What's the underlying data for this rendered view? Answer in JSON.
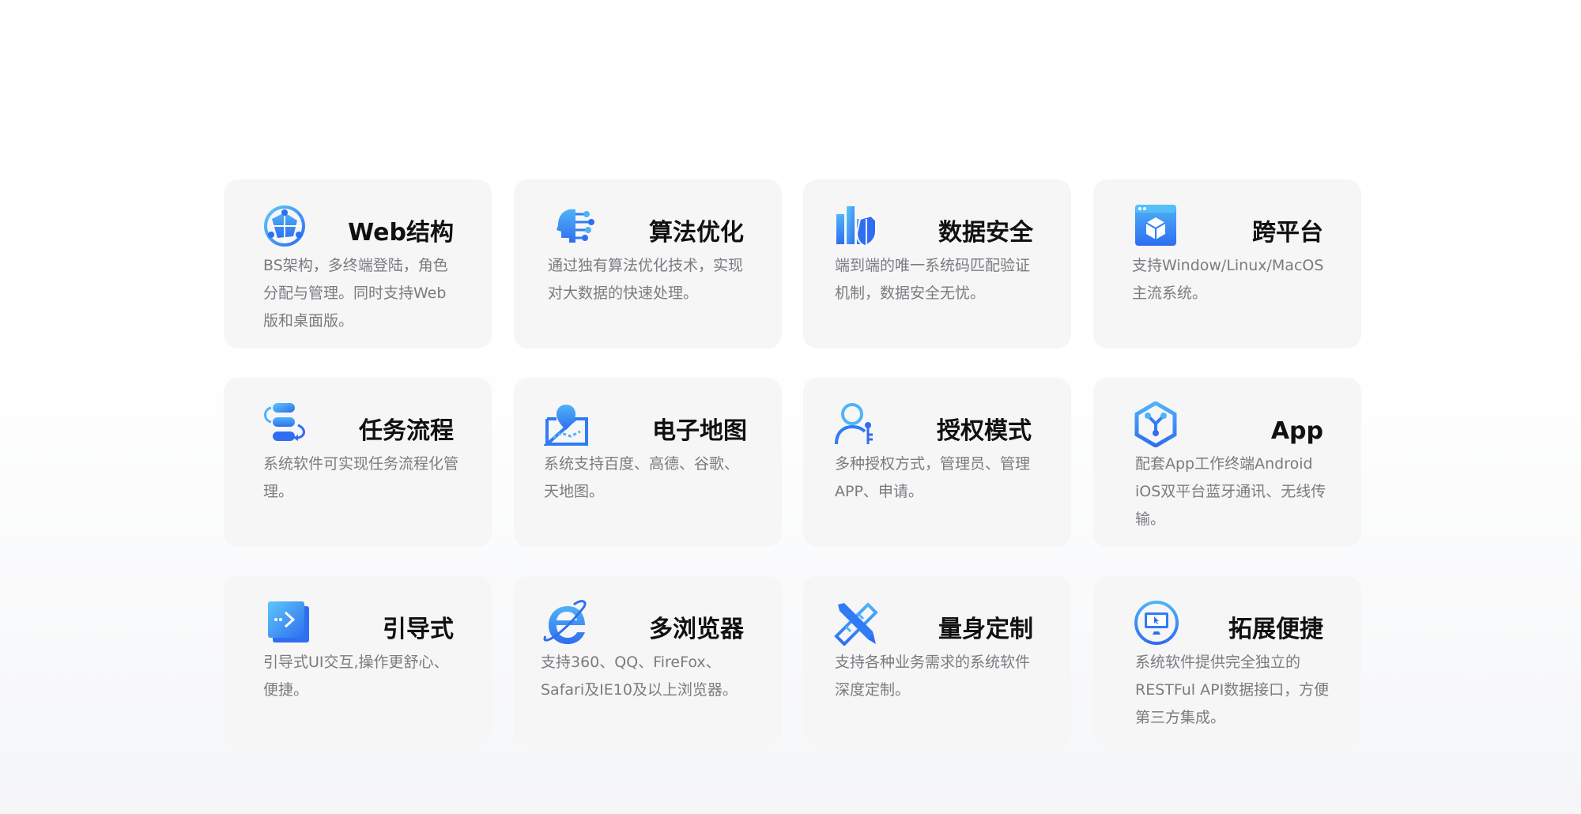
{
  "colors": {
    "accent": "#2f7cf6",
    "accent_light": "#4fb3f7",
    "card_bg": "#f6f6f7",
    "title": "#111111",
    "desc": "#7b7b80"
  },
  "features": [
    {
      "title": "Web结构",
      "desc": "BS架构，多终端登陆，角色分配与管理。同时支持Web版和桌面版。",
      "icon": "globe-network-icon"
    },
    {
      "title": "算法优化",
      "desc": "通过独有算法优化技术，实现对大数据的快速处理。",
      "icon": "ai-head-icon"
    },
    {
      "title": "数据安全",
      "desc": "端到端的唯一系统码匹配验证机制，数据安全无忧。",
      "icon": "shield-chart-icon"
    },
    {
      "title": "跨平台",
      "desc": "支持Window/Linux/MacOS主流系统。",
      "icon": "window-cube-icon"
    },
    {
      "title": "任务流程",
      "desc": "系统软件可实现任务流程化管理。",
      "icon": "workflow-icon"
    },
    {
      "title": "电子地图",
      "desc": "系统支持百度、高德、谷歌、天地图。",
      "icon": "map-pin-icon"
    },
    {
      "title": "授权模式",
      "desc": "多种授权方式，管理员、管理APP、申请。",
      "icon": "user-key-icon"
    },
    {
      "title": "App",
      "desc": "配套App工作终端Android iOS双平台蓝牙通讯、无线传输。",
      "icon": "app-hexagon-icon"
    },
    {
      "title": "引导式",
      "desc": "引导式UI交互,操作更舒心、便捷。",
      "icon": "guide-arrow-icon"
    },
    {
      "title": "多浏览器",
      "desc": "支持360、QQ、FireFox、Safari及IE10及以上浏览器。",
      "icon": "ie-browser-icon"
    },
    {
      "title": "量身定制",
      "desc": "支持各种业务需求的系统软件深度定制。",
      "icon": "ruler-pencil-icon"
    },
    {
      "title": "拓展便捷",
      "desc": "系统软件提供完全独立的RESTFul API数据接口，方便第三方集成。",
      "icon": "monitor-cursor-icon"
    }
  ]
}
